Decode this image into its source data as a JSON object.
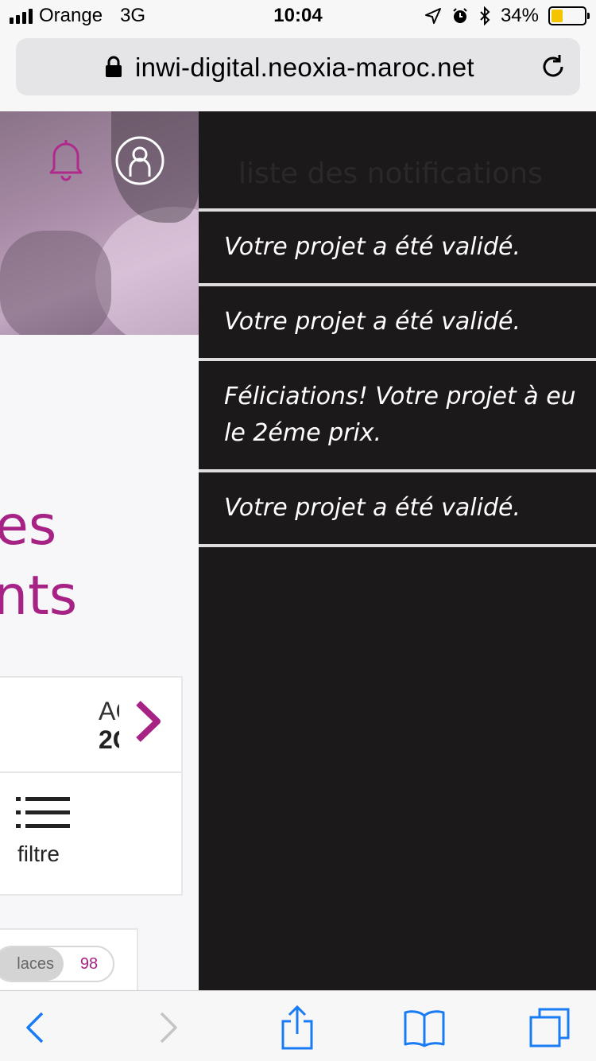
{
  "status_bar": {
    "carrier": "Orange",
    "network": "3G",
    "time": "10:04",
    "battery": "34%",
    "battery_level": 0.34,
    "battery_color": "#f5c400"
  },
  "browser": {
    "url": "inwi-digital.neoxia-maroc.net",
    "lock_icon": "lock-icon",
    "reload_icon": "reload-icon"
  },
  "page": {
    "header_icons": [
      "bell-icon",
      "user-icon"
    ],
    "title_line1": "es",
    "title_line2": "nts",
    "date_top": "AC",
    "date_bottom": "2C",
    "filter_label": "filtre",
    "toggle_left": "laces",
    "toggle_right": "98",
    "accent_color": "#a62285"
  },
  "notifications": {
    "title": "liste des notifications",
    "items": [
      "Votre projet a été validé.",
      "Votre projet a été validé.",
      "Féliciations! Votre projet à eu le 2éme prix.",
      "Votre projet a été validé."
    ],
    "panel_color": "#1c191b"
  },
  "toolbar": {
    "icons": [
      "back-icon",
      "forward-icon",
      "share-icon",
      "bookmarks-icon",
      "tabs-icon"
    ],
    "accent_color": "#1a7cf5"
  }
}
